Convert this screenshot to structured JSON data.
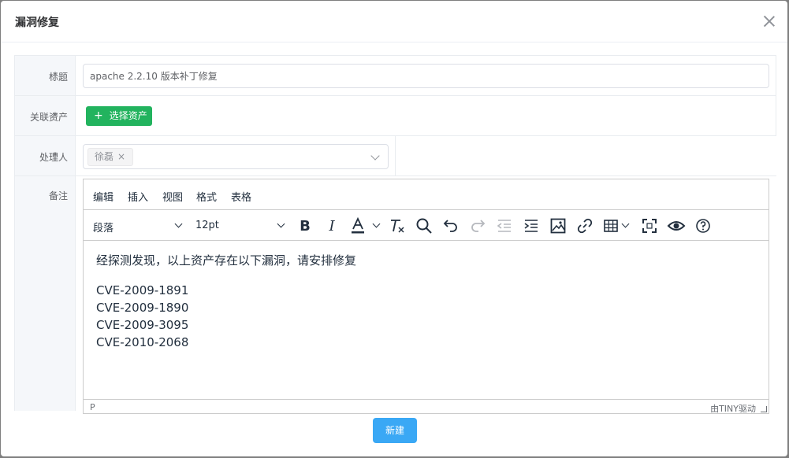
{
  "dialog": {
    "title": "漏洞修复",
    "close_glyph": "×"
  },
  "form": {
    "required_mark": "*",
    "title_field": {
      "label": "标题",
      "value": "apache 2.2.10 版本补丁修复"
    },
    "assets_field": {
      "label": "关联资产",
      "button_icon": "+",
      "button_label": "选择资产"
    },
    "assignee_field": {
      "label": "处理人",
      "tag": "徐磊",
      "tag_remove": "×"
    },
    "notes_field": {
      "label": "备注"
    }
  },
  "editor": {
    "menu": [
      "编辑",
      "插入",
      "视图",
      "格式",
      "表格"
    ],
    "block_format": "段落",
    "font_size": "12pt",
    "content_line": "经探测发现，以上资产存在以下漏洞，请安排修复",
    "cves": [
      "CVE-2009-1891",
      "CVE-2009-1890",
      "CVE-2009-3095",
      "CVE-2010-2068"
    ],
    "status_path": "P",
    "brand": "由TINY驱动"
  },
  "footer": {
    "submit_label": "新建"
  }
}
